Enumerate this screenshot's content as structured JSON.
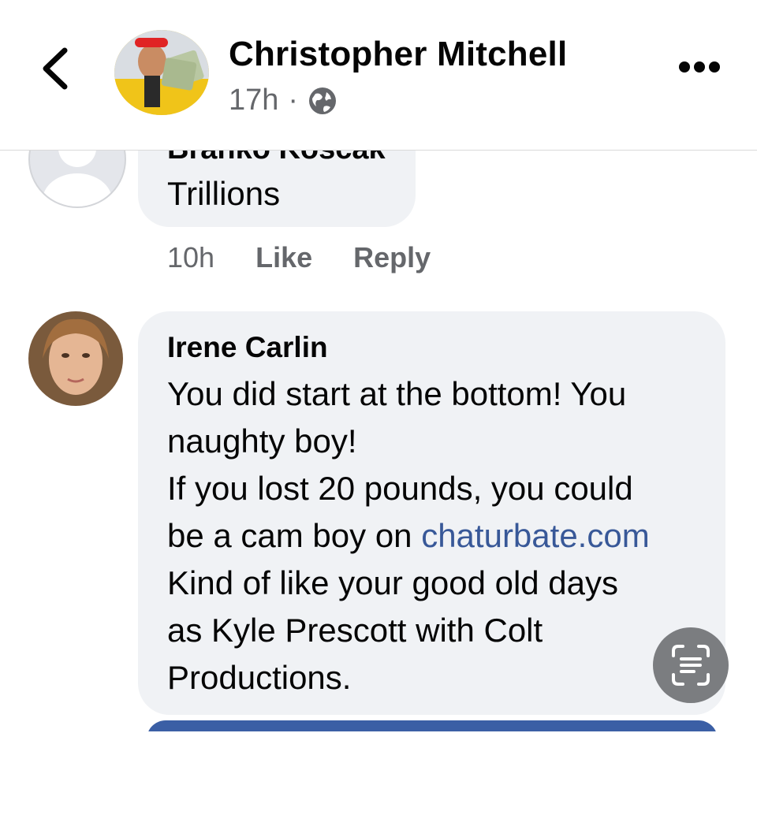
{
  "header": {
    "name": "Christopher Mitchell",
    "time": "17h",
    "separator": "·",
    "icons": {
      "back": "chevron-left-icon",
      "privacy": "globe-icon",
      "more": "more-dots-icon"
    }
  },
  "comments": [
    {
      "author": "Branko Koscak",
      "text": "Trillions",
      "time": "10h",
      "like_label": "Like",
      "reply_label": "Reply"
    },
    {
      "author": "Irene Carlin",
      "lines": [
        "You did start at the bottom! You",
        "naughty boy!",
        "If you lost 20 pounds, you could",
        "be a cam boy on ",
        "chaturbate.com",
        "Kind of like your good old days",
        "as Kyle Prescott with Colt",
        "Productions."
      ]
    }
  ],
  "colors": {
    "link": "#385898",
    "bubble": "#f0f2f5",
    "meta": "#65676b",
    "accent_bar": "#3b5fa5"
  },
  "floating": {
    "icon": "text-scan-icon"
  }
}
